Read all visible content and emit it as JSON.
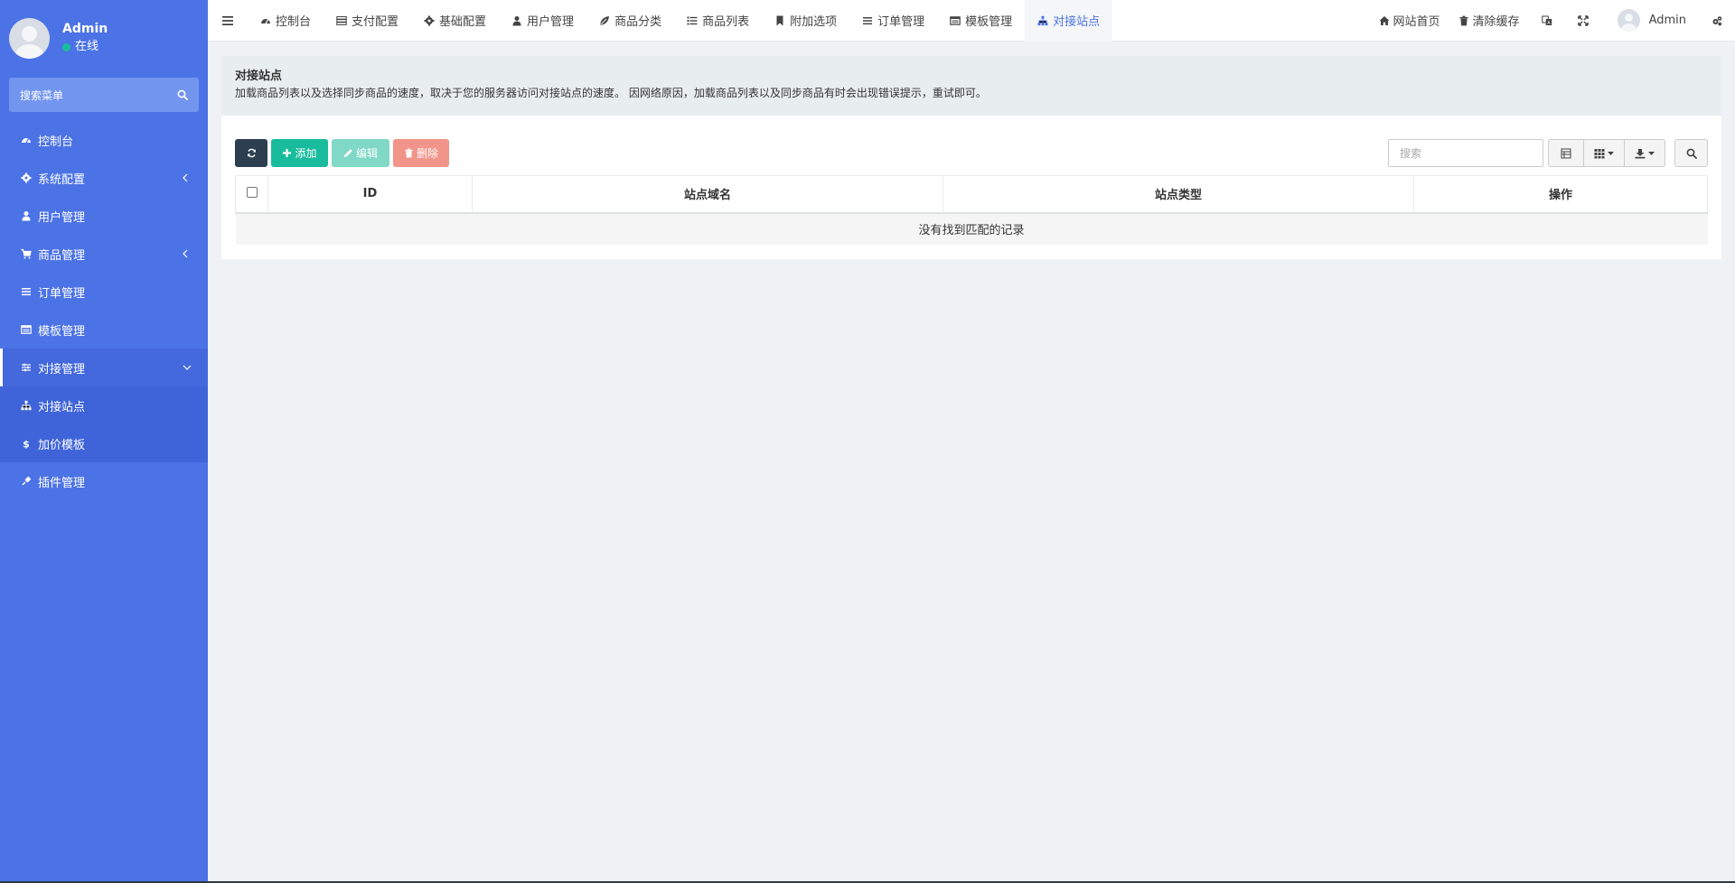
{
  "sidebar": {
    "user": {
      "name": "Admin",
      "status": "在线"
    },
    "search": {
      "placeholder": "搜索菜单"
    },
    "items": [
      {
        "label": "控制台",
        "icon": "dashboard-icon"
      },
      {
        "label": "系统配置",
        "icon": "gear-icon",
        "has_children": true
      },
      {
        "label": "用户管理",
        "icon": "user-icon"
      },
      {
        "label": "商品管理",
        "icon": "cart-icon",
        "has_children": true
      },
      {
        "label": "订单管理",
        "icon": "list-icon"
      },
      {
        "label": "模板管理",
        "icon": "template-icon"
      },
      {
        "label": "对接管理",
        "icon": "sliders-icon",
        "expanded": true,
        "children": [
          {
            "label": "对接站点",
            "icon": "sitemap-icon",
            "current": true
          },
          {
            "label": "加价模板",
            "icon": "dollar-icon"
          }
        ]
      },
      {
        "label": "插件管理",
        "icon": "plug-icon"
      }
    ]
  },
  "topbar": {
    "tabs": [
      {
        "label": "控制台",
        "icon": "dashboard-icon"
      },
      {
        "label": "支付配置",
        "icon": "server-icon"
      },
      {
        "label": "基础配置",
        "icon": "gear-icon"
      },
      {
        "label": "用户管理",
        "icon": "user-icon"
      },
      {
        "label": "商品分类",
        "icon": "leaf-icon"
      },
      {
        "label": "商品列表",
        "icon": "list-icon"
      },
      {
        "label": "附加选项",
        "icon": "bookmark-icon"
      },
      {
        "label": "订单管理",
        "icon": "bars-icon"
      },
      {
        "label": "模板管理",
        "icon": "template-icon"
      },
      {
        "label": "对接站点",
        "icon": "sitemap-icon",
        "active": true
      }
    ],
    "right": {
      "home_label": "网站首页",
      "clear_cache_label": "清除缓存",
      "user_name": "Admin"
    }
  },
  "panel": {
    "title": "对接站点",
    "description": "加载商品列表以及选择同步商品的速度，取决于您的服务器访问对接站点的速度。 因网络原因，加载商品列表以及同步商品有时会出现错误提示，重试即可。"
  },
  "toolbar": {
    "add_label": "添加",
    "edit_label": "编辑",
    "delete_label": "删除",
    "search_placeholder": "搜索"
  },
  "table": {
    "columns": [
      "ID",
      "站点域名",
      "站点类型",
      "操作"
    ],
    "empty_text": "没有找到匹配的记录"
  },
  "colors": {
    "sidebar_bg": "#4c73e6",
    "accent": "#4c73e6",
    "success": "#18bc9c",
    "danger": "#f1948a",
    "dark": "#2c3e50"
  }
}
